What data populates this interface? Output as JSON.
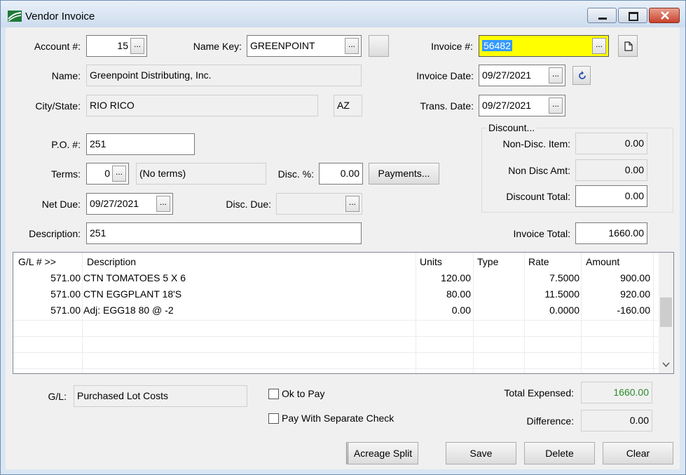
{
  "window": {
    "title": "Vendor Invoice"
  },
  "labels": {
    "account": "Account #:",
    "name_key": "Name Key:",
    "invoice_no": "Invoice #:",
    "name": "Name:",
    "invoice_date": "Invoice Date:",
    "city_state": "City/State:",
    "trans_date": "Trans. Date:",
    "po": "P.O. #:",
    "terms": "Terms:",
    "disc_pct": "Disc. %:",
    "net_due": "Net Due:",
    "disc_due": "Disc. Due:",
    "description": "Description:",
    "invoice_total": "Invoice Total:",
    "gl": "G/L:",
    "total_expensed": "Total Expensed:",
    "difference": "Difference:"
  },
  "fields": {
    "account": "15",
    "name_key": "GREENPOINT",
    "invoice_no": "56482",
    "name": "Greenpoint Distributing, Inc.",
    "invoice_date": "09/27/2021",
    "city": "RIO RICO",
    "state": "AZ",
    "trans_date": "09/27/2021",
    "po": "251",
    "terms": "0",
    "terms_text": "(No terms)",
    "disc_pct": "0.00",
    "net_due": "09/27/2021",
    "disc_due": "",
    "description": "251",
    "invoice_total": "1660.00",
    "gl": "Purchased Lot Costs",
    "total_expensed": "1660.00",
    "difference": "0.00"
  },
  "discount": {
    "legend": "Discount...",
    "non_disc_item_label": "Non-Disc. Item:",
    "non_disc_item": "0.00",
    "non_disc_amt_label": "Non Disc Amt:",
    "non_disc_amt": "0.00",
    "discount_total_label": "Discount Total:",
    "discount_total": "0.00"
  },
  "ellipsis": "...",
  "buttons": {
    "payments": "Payments...",
    "acreage_split": "Acreage Split",
    "save": "Save",
    "delete": "Delete",
    "clear": "Clear"
  },
  "checks": {
    "ok_to_pay": "Ok to Pay",
    "pay_separate": "Pay With Separate Check"
  },
  "grid": {
    "headers": {
      "gl": "G/L # >>",
      "description": "Description",
      "units": "Units",
      "type": "Type",
      "rate": "Rate",
      "amount": "Amount"
    },
    "rows": [
      {
        "gl": "571.00",
        "description": "CTN TOMATOES 5 X 6",
        "units": "120.00",
        "type": "",
        "rate": "7.5000",
        "amount": "900.00"
      },
      {
        "gl": "571.00",
        "description": "CTN EGGPLANT 18'S",
        "units": "80.00",
        "type": "",
        "rate": "11.5000",
        "amount": "920.00"
      },
      {
        "gl": "571.00",
        "description": "Adj: EGG18 80 @ -2",
        "units": "0.00",
        "type": "",
        "rate": "0.0000",
        "amount": "-160.00"
      }
    ]
  },
  "colors": {
    "invoice_highlight": "#ffff00",
    "selection": "#3399ff",
    "total_expensed": "#2e8b2e"
  }
}
